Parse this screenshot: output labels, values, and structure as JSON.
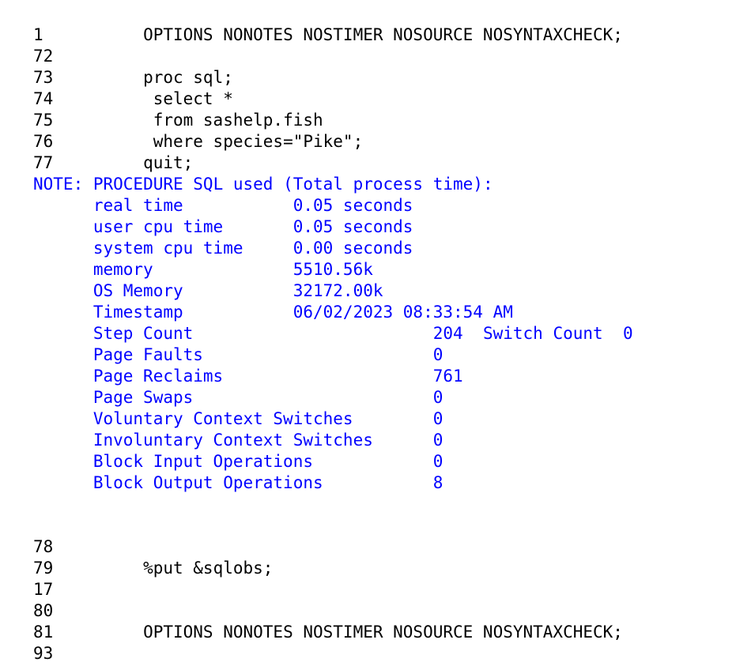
{
  "colors": {
    "code": "#000000",
    "note": "#0000ff"
  },
  "log_top": [
    {
      "num": "1",
      "code": "OPTIONS NONOTES NOSTIMER NOSOURCE NOSYNTAXCHECK;",
      "indent": 0
    },
    {
      "num": "72",
      "code": "",
      "indent": 0
    },
    {
      "num": "73",
      "code": "proc sql;",
      "indent": 0
    },
    {
      "num": "74",
      "code": "select *",
      "indent": 1
    },
    {
      "num": "75",
      "code": "from sashelp.fish",
      "indent": 1
    },
    {
      "num": "76",
      "code": "where species=\"Pike\";",
      "indent": 1
    },
    {
      "num": "77",
      "code": "quit;",
      "indent": 0
    }
  ],
  "note": {
    "header": "NOTE: PROCEDURE SQL used (Total process time):",
    "metrics": [
      {
        "label": "real time",
        "value": "0.05 seconds"
      },
      {
        "label": "user cpu time",
        "value": "0.05 seconds"
      },
      {
        "label": "system cpu time",
        "value": "0.00 seconds"
      },
      {
        "label": "memory",
        "value": "5510.56k"
      },
      {
        "label": "OS Memory",
        "value": "32172.00k"
      },
      {
        "label": "Timestamp",
        "value": "06/02/2023 08:33:54 AM"
      }
    ],
    "step_count": {
      "label": "Step Count",
      "value": "204",
      "switch_label": "Switch Count",
      "switch_value": "0"
    },
    "counts": [
      {
        "label": "Page Faults",
        "value": "0"
      },
      {
        "label": "Page Reclaims",
        "value": "761"
      },
      {
        "label": "Page Swaps",
        "value": "0"
      },
      {
        "label": "Voluntary Context Switches",
        "value": "0"
      },
      {
        "label": "Involuntary Context Switches",
        "value": "0"
      },
      {
        "label": "Block Input Operations",
        "value": "0"
      },
      {
        "label": "Block Output Operations",
        "value": "8"
      }
    ]
  },
  "log_bottom": [
    {
      "num": "78",
      "code": "",
      "indent": 0
    },
    {
      "num": "79",
      "code": "%put &sqlobs;",
      "indent": 0
    },
    {
      "num": "17",
      "code": "",
      "indent": 0
    },
    {
      "num": "80",
      "code": "",
      "indent": 0
    },
    {
      "num": "81",
      "code": "OPTIONS NONOTES NOSTIMER NOSOURCE NOSYNTAXCHECK;",
      "indent": 0
    },
    {
      "num": "93",
      "code": "",
      "indent": 0
    }
  ]
}
